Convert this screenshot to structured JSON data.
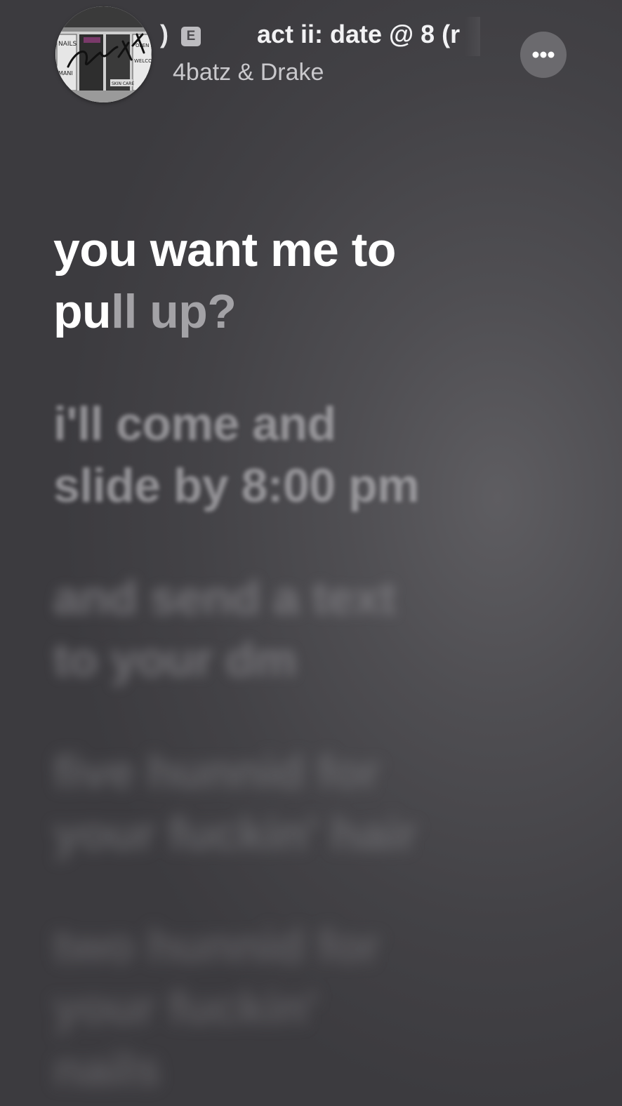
{
  "header": {
    "title_prev_fragment": ")",
    "explicit_badge": "E",
    "title": "act ii: date @ 8 (r",
    "artist": "4batz & Drake",
    "artwork_icon": "album-art-remix",
    "more_icon": "ellipsis-icon"
  },
  "lyrics": {
    "active": {
      "line1": "you want me to",
      "line2_sung": "pu",
      "line2_rest": "ll up?"
    },
    "upcoming": [
      {
        "line1": "i'll come and",
        "line2": "slide by 8:00 pm"
      },
      {
        "line1": "and send a text",
        "line2": "to your dm"
      },
      {
        "line1": "five hunnid for",
        "line2": "your fuckin' hair"
      },
      {
        "line1": "two hunnid for",
        "line2": "your fuckin'",
        "line3": "nails"
      }
    ]
  },
  "colors": {
    "background": "#4b4a4e",
    "lyric_active": "#ffffff",
    "lyric_dim": "#a3a2a6",
    "more_button": "#6b6a6e"
  }
}
